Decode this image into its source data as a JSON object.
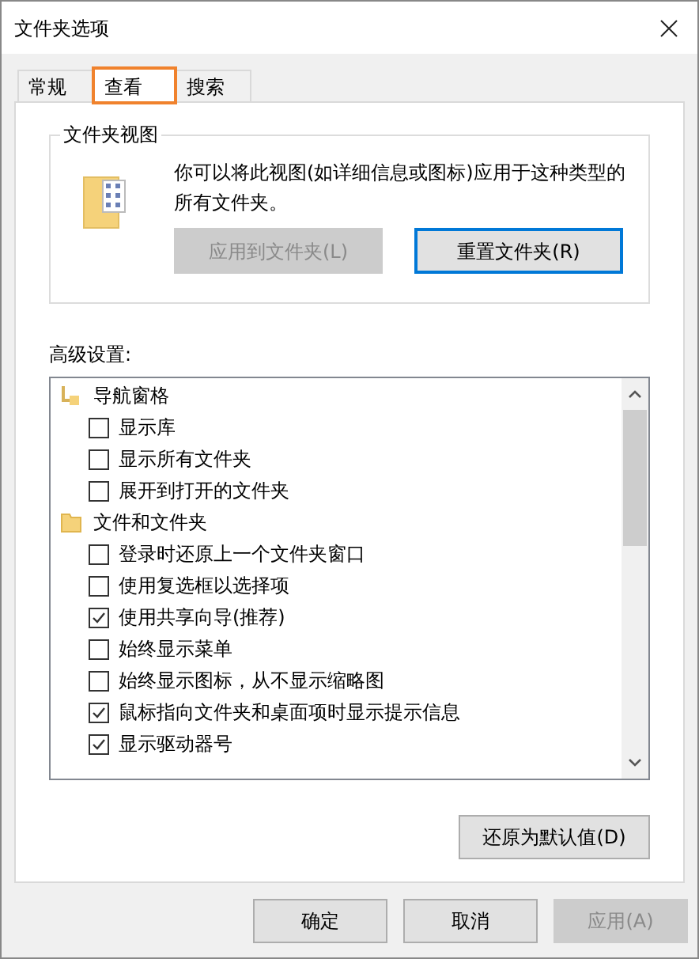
{
  "window": {
    "title": "文件夹选项"
  },
  "tabs": [
    {
      "label": "常规",
      "selected": false,
      "highlighted": false
    },
    {
      "label": "查看",
      "selected": true,
      "highlighted": true
    },
    {
      "label": "搜索",
      "selected": false,
      "highlighted": false
    }
  ],
  "folder_views": {
    "title": "文件夹视图",
    "description": "你可以将此视图(如详细信息或图标)应用于这种类型的所有文件夹。",
    "buttons": [
      {
        "label": "应用到文件夹(L)",
        "disabled": true,
        "default": false
      },
      {
        "label": "重置文件夹(R)",
        "disabled": false,
        "default": true
      }
    ]
  },
  "advanced": {
    "label": "高级设置:",
    "items": [
      {
        "kind": "navigation",
        "label": "导航窗格",
        "children": [
          {
            "label": "显示库",
            "checked": false
          },
          {
            "label": "显示所有文件夹",
            "checked": false
          },
          {
            "label": "展开到打开的文件夹",
            "checked": false
          }
        ]
      },
      {
        "kind": "folder",
        "label": "文件和文件夹",
        "children": [
          {
            "label": "登录时还原上一个文件夹窗口",
            "checked": false
          },
          {
            "label": "使用复选框以选择项",
            "checked": false
          },
          {
            "label": "使用共享向导(推荐)",
            "checked": true
          },
          {
            "label": "始终显示菜单",
            "checked": false
          },
          {
            "label": "始终显示图标，从不显示缩略图",
            "checked": false
          },
          {
            "label": "鼠标指向文件夹和桌面项时显示提示信息",
            "checked": true
          },
          {
            "label": "显示驱动器号",
            "checked": true
          }
        ]
      }
    ],
    "restore_button": "还原为默认值(D)"
  },
  "buttons": [
    {
      "label": "确定",
      "disabled": false
    },
    {
      "label": "取消",
      "disabled": false
    },
    {
      "label": "应用(A)",
      "disabled": true
    }
  ]
}
